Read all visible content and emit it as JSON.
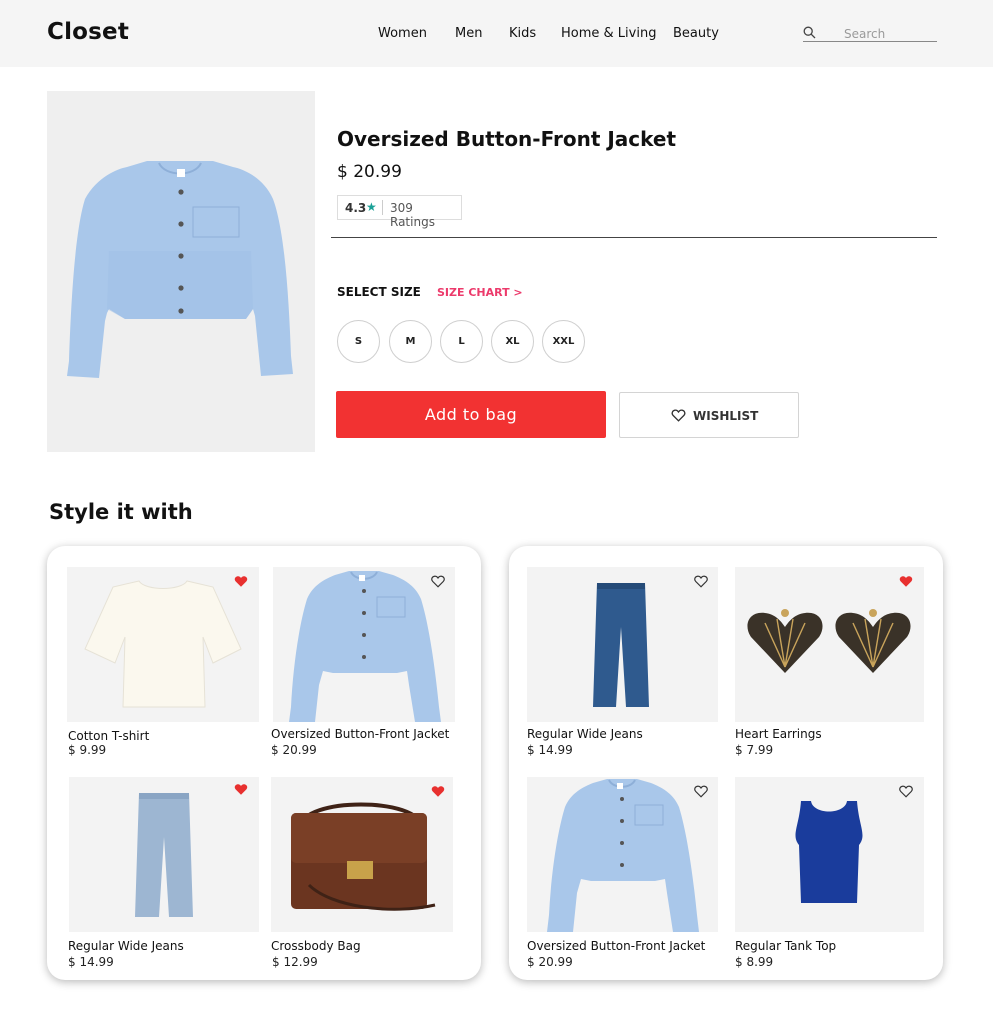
{
  "header": {
    "logo": "Closet",
    "nav": [
      "Women",
      "Men",
      "Kids",
      "Home & Living",
      "Beauty"
    ],
    "search_placeholder": "Search"
  },
  "product": {
    "title": "Oversized Button-Front Jacket",
    "price": "$ 20.99",
    "rating": "4.3",
    "rating_star": "★",
    "ratings_count": "309 Ratings",
    "select_size_label": "SELECT SIZE",
    "size_chart_label": "SIZE CHART >",
    "sizes": [
      "S",
      "M",
      "L",
      "XL",
      "XXL"
    ],
    "add_to_bag_label": "Add to bag",
    "wishlist_label": "WISHLIST"
  },
  "style_section": {
    "heading": "Style it with",
    "cards": [
      {
        "items": [
          {
            "name": "Cotton T-shirt",
            "price": "$ 9.99",
            "liked": true,
            "image": "tshirt"
          },
          {
            "name": "Oversized Button-Front Jacket",
            "price": "$ 20.99",
            "liked": false,
            "image": "jacket"
          },
          {
            "name": "Regular Wide Jeans",
            "price": "$ 14.99",
            "liked": true,
            "image": "light-jeans"
          },
          {
            "name": "Crossbody Bag",
            "price": "$ 12.99",
            "liked": true,
            "image": "bag"
          }
        ]
      },
      {
        "items": [
          {
            "name": "Regular Wide Jeans",
            "price": "$ 14.99",
            "liked": false,
            "image": "dark-jeans"
          },
          {
            "name": "Heart Earrings",
            "price": "$ 7.99",
            "liked": true,
            "image": "earrings"
          },
          {
            "name": "Oversized Button-Front Jacket",
            "price": "$ 20.99",
            "liked": false,
            "image": "jacket"
          },
          {
            "name": "Regular Tank Top",
            "price": "$ 8.99",
            "liked": false,
            "image": "tank"
          }
        ]
      }
    ]
  },
  "colors": {
    "accent_red": "#f23232",
    "size_chart_pink": "#ec3a6b",
    "rating_star_teal": "#1aa197",
    "heart_liked": "#e8302f",
    "header_bg": "#f5f5f5"
  }
}
